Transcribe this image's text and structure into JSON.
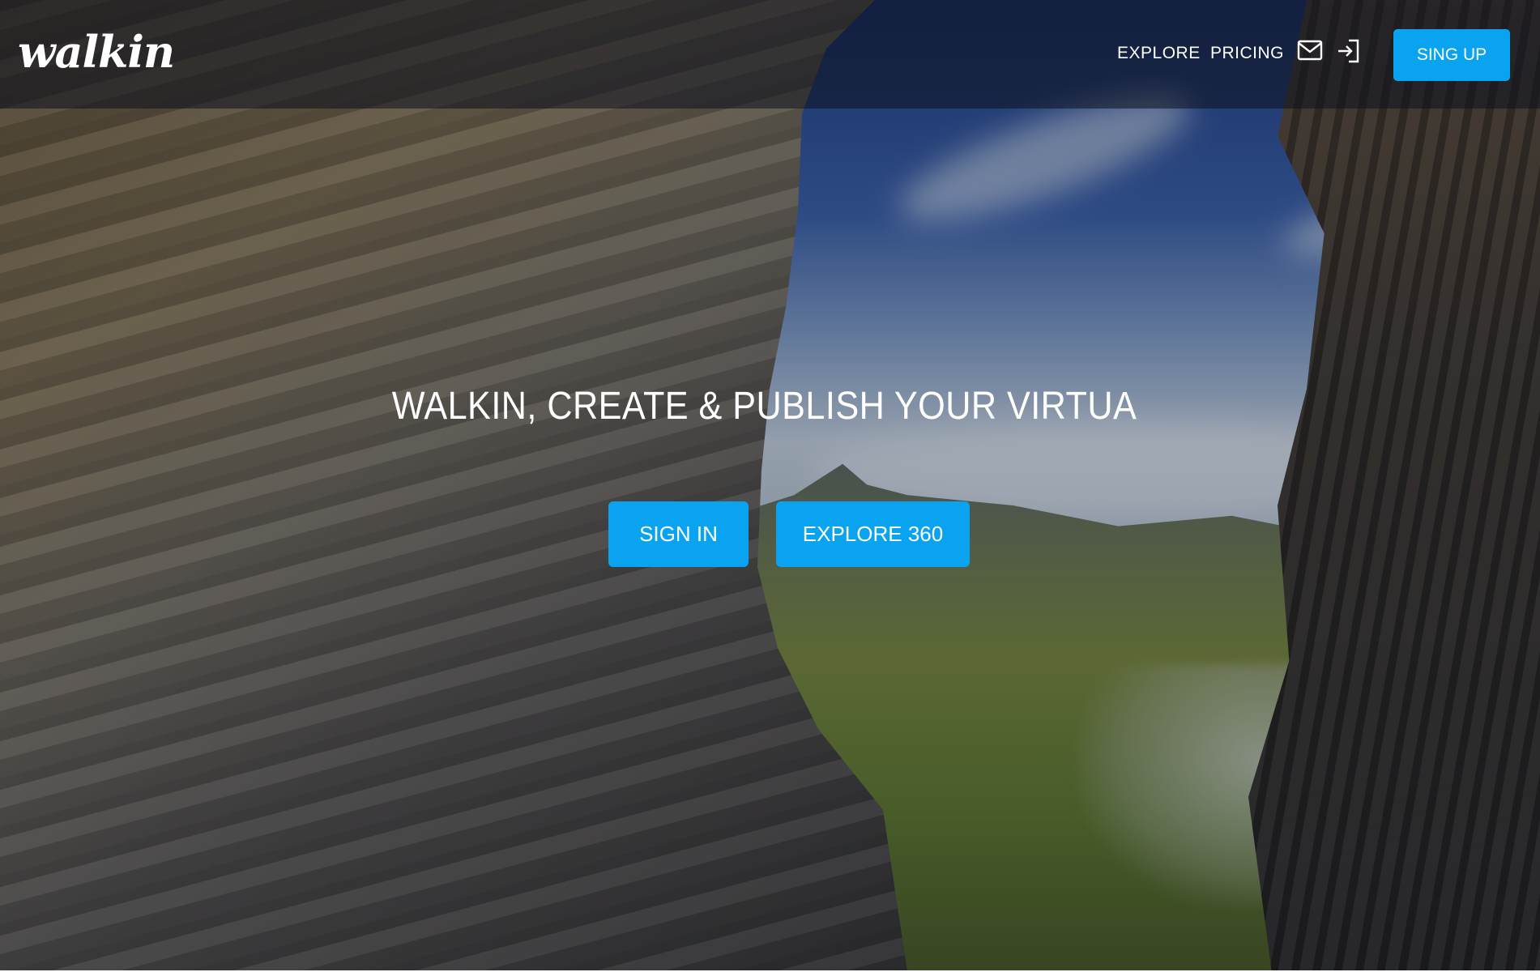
{
  "brand": {
    "logo_text": "walkin"
  },
  "nav": {
    "links": [
      "EXPLORE",
      "PRICING"
    ],
    "icons": [
      "mail-icon",
      "sign-in-icon"
    ],
    "signup_label": "SING UP"
  },
  "hero": {
    "title": "WALKIN, CREATE & PUBLISH YOUR VIRTUA",
    "buttons": [
      "SIGN IN",
      "EXPLORE 360"
    ]
  },
  "colors": {
    "accent": "#0aa3f0",
    "header_overlay": "rgba(12,16,30,0.55)",
    "text": "#ffffff"
  }
}
